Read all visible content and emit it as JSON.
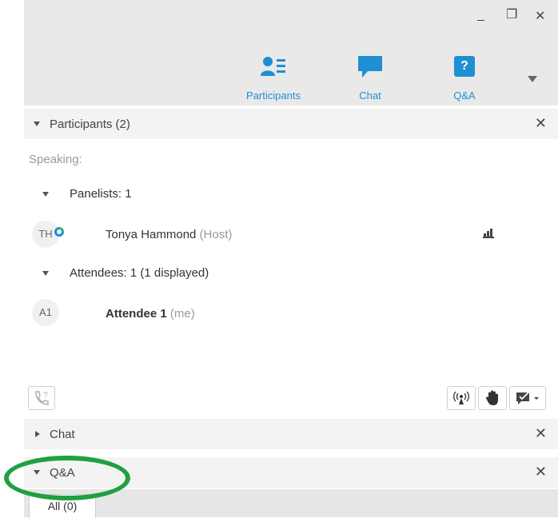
{
  "window": {
    "minimize": "_",
    "restore": "❐",
    "close": "✕"
  },
  "toolbar": {
    "participants_label": "Participants",
    "chat_label": "Chat",
    "qa_label": "Q&A",
    "qa_icon_glyph": "?"
  },
  "participants_panel": {
    "title": "Participants (2)",
    "speaking_label": "Speaking:",
    "panelists_label": "Panelists: 1",
    "panelist": {
      "initials": "TH",
      "name": "Tonya Hammond",
      "role": "(Host)"
    },
    "attendees_label": "Attendees: 1 (1 displayed)",
    "attendee": {
      "initials": "A1",
      "name": "Attendee 1",
      "tag": "(me)"
    }
  },
  "chat_panel": {
    "title": "Chat"
  },
  "qa_panel": {
    "title": "Q&A",
    "tab_all": "All (0)"
  },
  "colors": {
    "accent": "#1f8fd3",
    "annotation_oval": "#20a040"
  }
}
